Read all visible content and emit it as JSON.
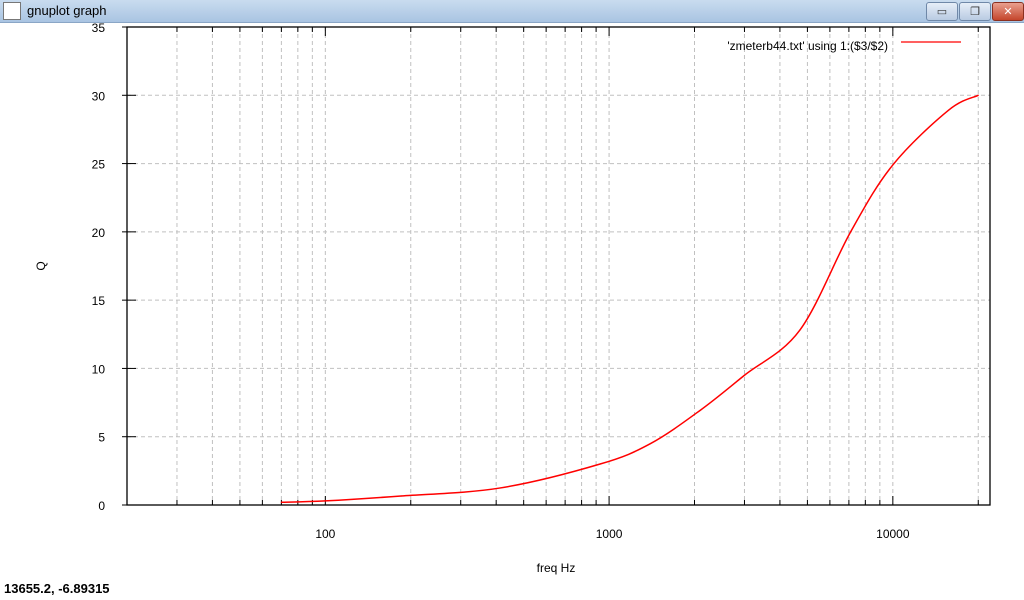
{
  "window": {
    "title": "gnuplot graph",
    "minimize": "▭",
    "restore": "❐",
    "close": "✕"
  },
  "status": "13655.2, -6.89315",
  "chart_data": {
    "type": "line",
    "title": "",
    "xlabel": "freq Hz",
    "ylabel": "Q",
    "xscale": "log",
    "xlim": [
      20,
      22000
    ],
    "ylim": [
      0,
      35
    ],
    "xticks": [
      100,
      1000,
      10000
    ],
    "xtick_labels": [
      "100",
      "1000",
      "10000"
    ],
    "yticks": [
      0,
      5,
      10,
      15,
      20,
      25,
      30,
      35
    ],
    "ytick_labels": [
      "0",
      "5",
      "10",
      "15",
      "20",
      "25",
      "30",
      "35"
    ],
    "grid": true,
    "legend": "top-right",
    "series": [
      {
        "name": "'zmeterb44.txt' using 1:($3/$2)",
        "color": "#ff0000",
        "x": [
          70,
          100,
          185,
          414,
          930,
          1400,
          2100,
          3000,
          4700,
          7100,
          10000,
          15700,
          20000
        ],
        "y": [
          0.2,
          0.3,
          0.66,
          1.25,
          3.0,
          4.5,
          6.95,
          9.5,
          12.8,
          20.0,
          24.9,
          28.9,
          30.0
        ]
      }
    ]
  }
}
